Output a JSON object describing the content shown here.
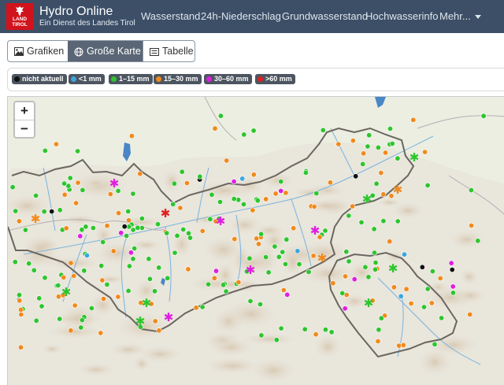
{
  "navbar": {
    "logo_text": [
      "LAND",
      "TIROL"
    ],
    "title": "Hydro Online",
    "subtitle": "Ein Dienst des Landes Tirol",
    "links": [
      "Wasserstand",
      "24h-Niederschlag",
      "Grundwasserstand",
      "Hochwasserinfo",
      "Mehr..."
    ]
  },
  "views": [
    {
      "label": "Grafiken",
      "icon": "image-icon",
      "active": false
    },
    {
      "label": "Große Karte",
      "icon": "globe-icon",
      "active": true
    },
    {
      "label": "Tabelle",
      "icon": "table-icon",
      "active": false
    }
  ],
  "legend": [
    {
      "label": "nicht aktuell",
      "color": "#111111"
    },
    {
      "label": "<1 mm",
      "color": "#3aa6e0"
    },
    {
      "label": "1–15 mm",
      "color": "#2ec52e"
    },
    {
      "label": "15–30 mm",
      "color": "#f08a1c"
    },
    {
      "label": "30–60 mm",
      "color": "#e01ee0"
    },
    {
      "label": ">60 mm",
      "color": "#e02020"
    }
  ],
  "map": {
    "zoom_in": "+",
    "zoom_out": "−",
    "colors": {
      "terrain": "#e9e6dc",
      "border": "#6b6660",
      "river": "#7ab3dd",
      "lake": "#4a86c6"
    }
  }
}
